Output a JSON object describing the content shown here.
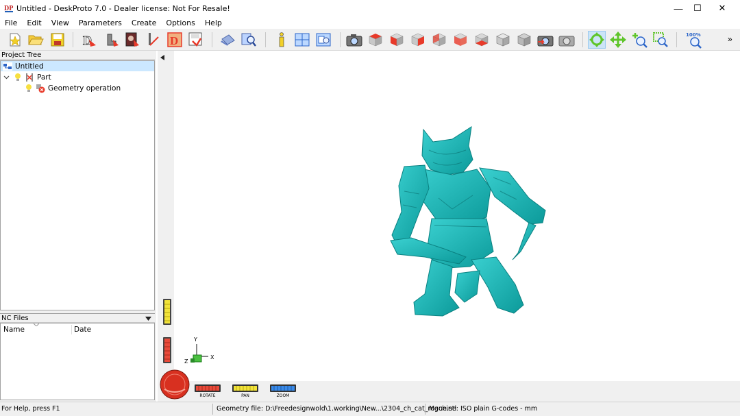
{
  "window": {
    "title": "Untitled - DeskProto 7.0 - Dealer license: Not For Resale!",
    "app_icon_text": "DP",
    "minimize_glyph": "—",
    "maximize_glyph": "☐",
    "close_glyph": "✕"
  },
  "menu": [
    "File",
    "Edit",
    "View",
    "Parameters",
    "Create",
    "Options",
    "Help"
  ],
  "toolbar": {
    "zoom_label": "100%",
    "overflow_glyph": "»",
    "accent_color": "#e83a2a",
    "tool_green": "#5fc52a"
  },
  "project_tree": {
    "header": "Project Tree",
    "items": [
      {
        "label": "Untitled",
        "icon": "project-icon",
        "selected": true
      },
      {
        "label": "Part",
        "icon": "part-icon",
        "expanded": true
      },
      {
        "label": "Geometry operation",
        "icon": "geometry-operation-icon"
      }
    ]
  },
  "nc_files": {
    "header": "NC Files",
    "columns": [
      "Name",
      "Date"
    ]
  },
  "viewport": {
    "model_color": "#1ab8b8",
    "axes": {
      "x": "X",
      "y": "Y",
      "z": "Z"
    },
    "dials": [
      {
        "label": "ROTATE",
        "color": "#e84a3a"
      },
      {
        "label": "PAN",
        "color": "#f2e33a"
      },
      {
        "label": "ZOOM",
        "color": "#3a8ae8"
      }
    ]
  },
  "status": {
    "help": "For Help, press F1",
    "geometry": "Geometry file: D:\\Freedesignwold\\1.working\\New...\\2304_ch_cat_rogue.stl",
    "machine": "Machine: ISO plain G-codes - mm"
  }
}
